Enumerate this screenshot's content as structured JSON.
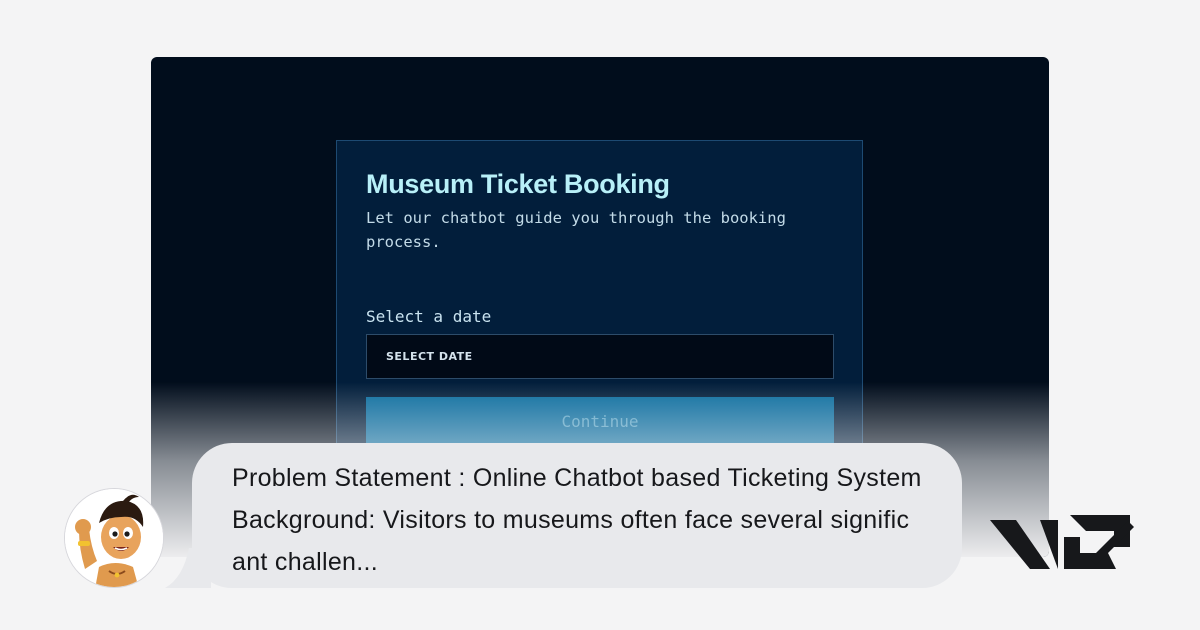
{
  "app": {
    "card": {
      "title": "Museum Ticket Booking",
      "subtitle": "Let our chatbot guide you through the booking process.",
      "date_label": "Select a date",
      "date_select_value": "SELECT DATE",
      "continue_label": "Continue"
    }
  },
  "overlay": {
    "message": "Problem Statement : Online Chatbot based Ticketing System Background: Visitors to museums often face several significant challen..."
  },
  "icons": {
    "avatar": "cartoon-boy-avatar-icon",
    "logo": "v0-logo-icon"
  },
  "colors": {
    "page_background": "#f4f4f5",
    "app_background": "#010d1c",
    "card_background": "#021e3b",
    "title_color": "#b8f0f8",
    "button_background": "#0a6c9e",
    "bubble_background": "#e8e9ec"
  }
}
